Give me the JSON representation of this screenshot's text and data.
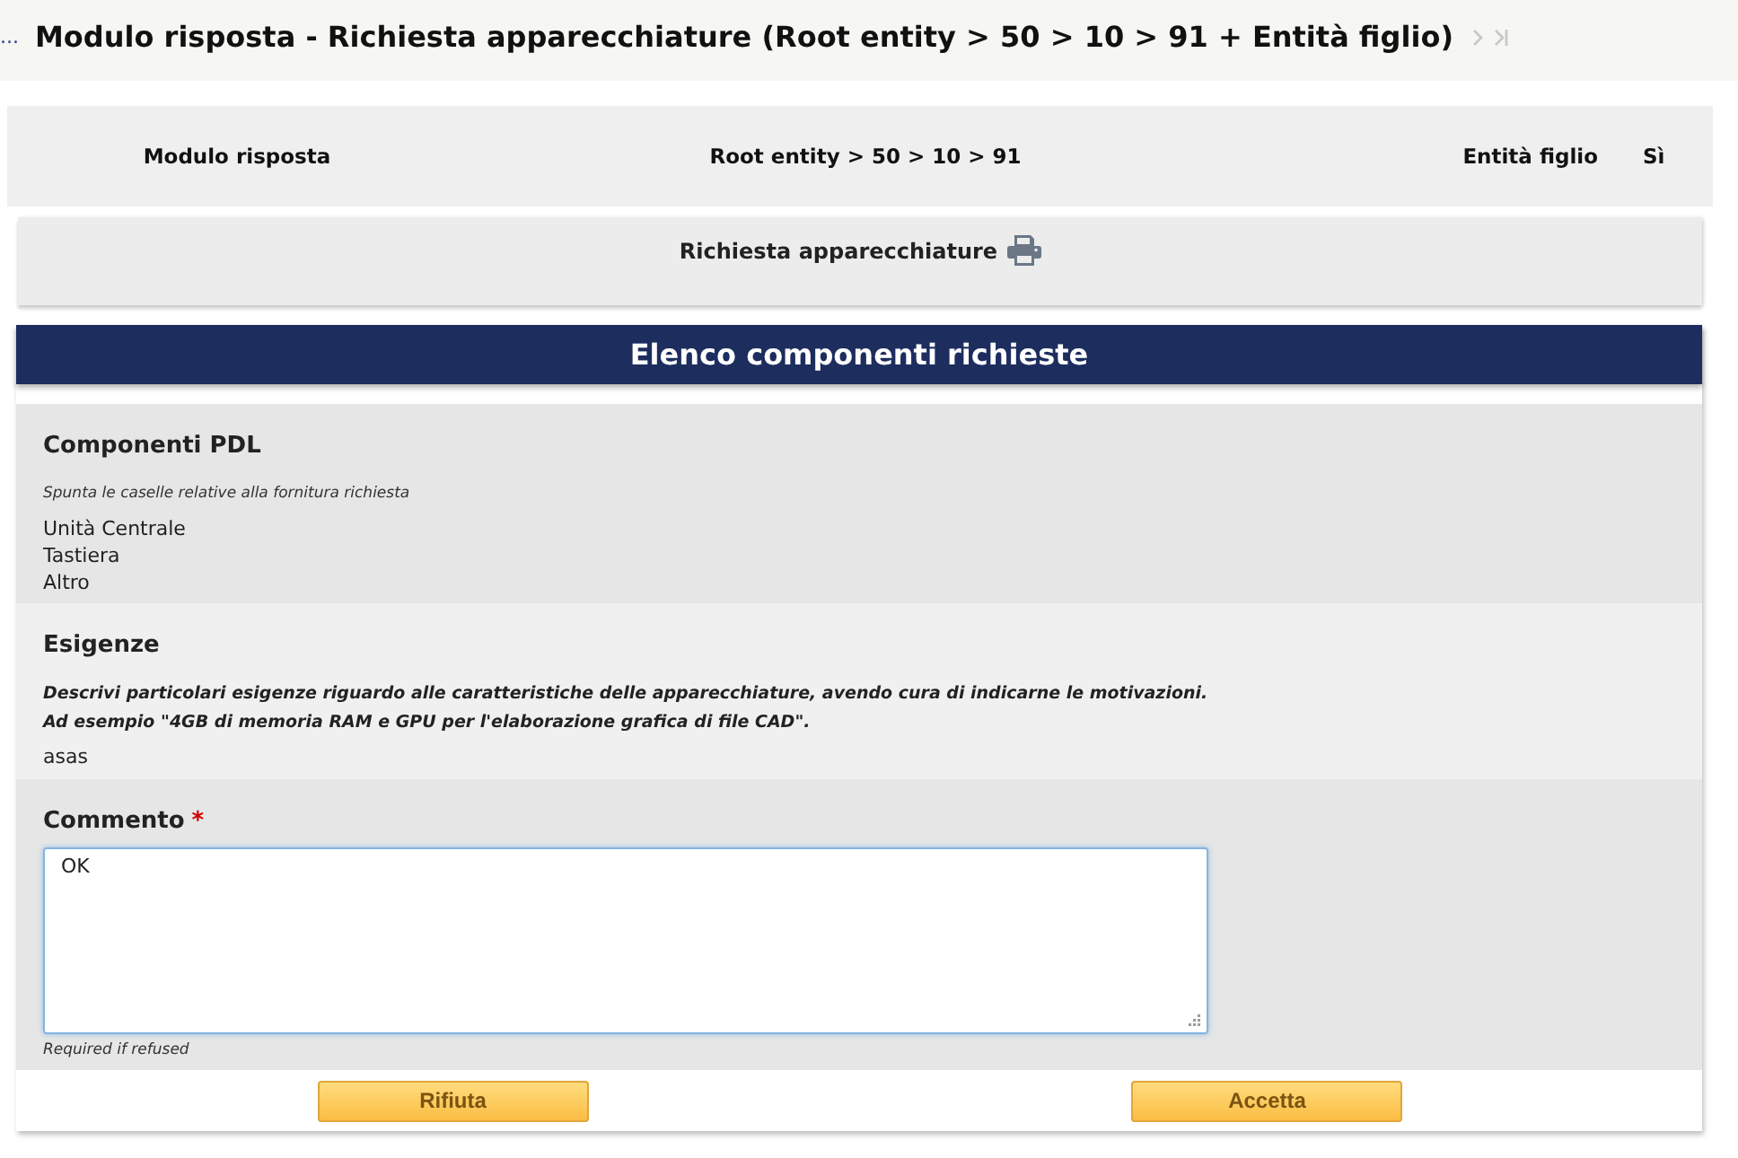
{
  "header": {
    "overflow_link": "...",
    "title": "Modulo risposta - Richiesta apparecchiature (Root entity > 50 > 10 > 91 + Entità figlio)",
    "nav": [
      {
        "kind": "next",
        "disabled": true
      },
      {
        "kind": "last",
        "disabled": true
      }
    ]
  },
  "info_bar": [
    {
      "kind": "left",
      "text": "Modulo risposta"
    },
    {
      "kind": "center",
      "text": "Root entity > 50 > 10 > 91"
    },
    {
      "kind": "right",
      "text": "Entità figlio"
    },
    {
      "kind": "value",
      "text": "Sì"
    }
  ],
  "form_card": {
    "title": "Richiesta apparecchiature"
  },
  "panel": {
    "title": "Elenco componenti richieste",
    "sections": [
      {
        "kind": "list",
        "title": "Componenti PDL",
        "hint": [
          "Spunta le caselle relative alla fornitura richiesta"
        ],
        "items": [
          "Unità Centrale",
          "Tastiera",
          "Altro"
        ]
      },
      {
        "kind": "text",
        "title": "Esigenze",
        "hint": [
          "Descrivi particolari esigenze riguardo alle caratteristiche delle apparecchiature, avendo cura di indicarne le motivazioni.",
          "Ad esempio \"4GB di memoria RAM e GPU per l'elaborazione grafica di file CAD\"."
        ],
        "value": "asas"
      },
      {
        "kind": "comment",
        "title": "Commento",
        "required_mark": "*",
        "value": "OK",
        "note": "Required if refused"
      }
    ],
    "buttons": [
      {
        "label": "Rifiuta"
      },
      {
        "label": "Accetta"
      }
    ]
  }
}
